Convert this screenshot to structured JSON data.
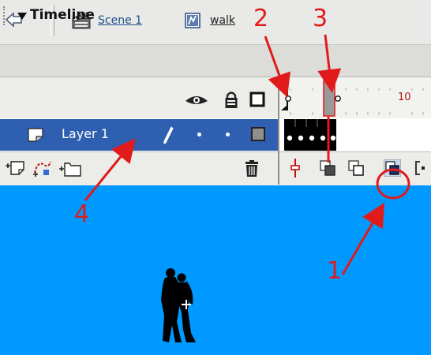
{
  "header": {
    "scene_label": "Scene 1",
    "symbol_label": "walk",
    "icons": [
      "back-arrow-icon",
      "scene-clapper-icon",
      "movieclip-symbol-icon"
    ]
  },
  "timeline": {
    "title": "Timeline",
    "column_icons": [
      "eye-icon",
      "lock-icon",
      "outline-icon"
    ],
    "ruler_label": "10",
    "layer": {
      "name": "Layer 1",
      "icons": [
        "layer-icon",
        "pencil-icon",
        "outline-color-icon"
      ]
    },
    "toolbar_left_icons": [
      "insert-layer-icon",
      "add-motion-guide-icon",
      "insert-folder-icon",
      "delete-layer-icon"
    ],
    "toolbar_right_icons": [
      "center-frame-icon",
      "onion-skin-icon",
      "onion-skin-outlines-icon",
      "edit-multiple-frames-icon",
      "modify-onion-markers-icon"
    ]
  },
  "annotations": {
    "labels": [
      "1",
      "2",
      "3",
      "4"
    ],
    "color": "#e11b1b"
  },
  "colors": {
    "stage": "#0099ff",
    "layer_selected": "#2f5fb0",
    "annotation": "#e11b1b"
  }
}
